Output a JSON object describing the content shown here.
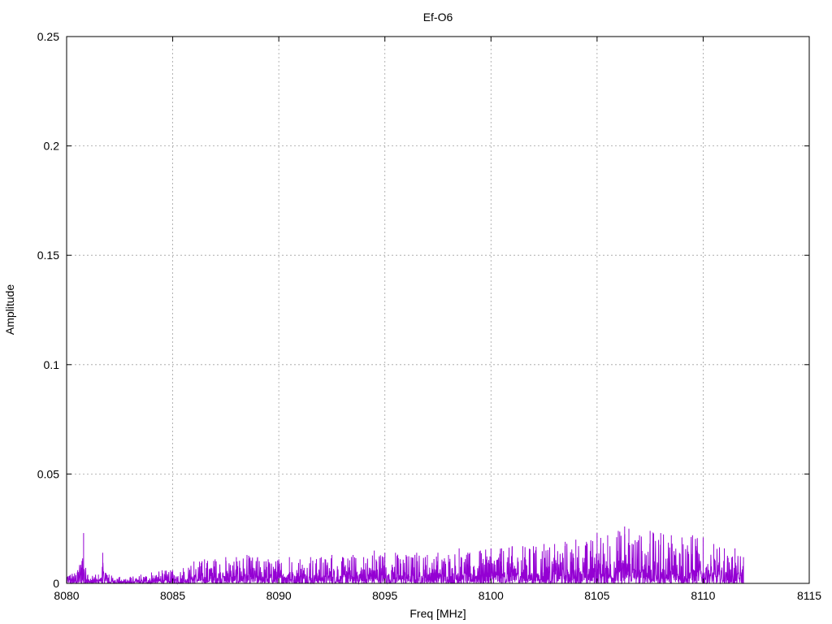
{
  "chart_data": {
    "type": "line",
    "title": "Ef-O6",
    "xlabel": "Freq [MHz]",
    "ylabel": "Amplitude",
    "xlim": [
      8080,
      8115
    ],
    "ylim": [
      0,
      0.25
    ],
    "xticks": [
      "8080",
      "8085",
      "8090",
      "8095",
      "8100",
      "8105",
      "8110",
      "8115"
    ],
    "yticks": [
      "0",
      "0.05",
      "0.1",
      "0.15",
      "0.2",
      "0.25"
    ],
    "grid": true,
    "series": [
      {
        "color": "#9400d3",
        "x": [
          8080.0,
          8080.5,
          8080.8,
          8081.0,
          8081.5,
          8081.7,
          8082.0,
          8082.5,
          8083.0,
          8083.5,
          8084.0,
          8084.5,
          8085.0,
          8085.5,
          8086.0,
          8086.5,
          8087.0,
          8087.5,
          8088.0,
          8088.5,
          8089.0,
          8089.5,
          8090.0,
          8090.5,
          8091.0,
          8091.5,
          8092.0,
          8092.5,
          8093.0,
          8093.5,
          8094.0,
          8094.5,
          8095.0,
          8095.5,
          8096.0,
          8096.5,
          8097.0,
          8097.5,
          8098.0,
          8098.5,
          8099.0,
          8099.5,
          8100.0,
          8100.5,
          8101.0,
          8101.5,
          8102.0,
          8102.5,
          8103.0,
          8103.5,
          8104.0,
          8104.5,
          8105.0,
          8105.5,
          8106.0,
          8106.3,
          8106.5,
          8107.0,
          8107.5,
          8108.0,
          8108.5,
          8109.0,
          8109.5,
          8110.0,
          8110.5,
          8111.0,
          8111.5,
          8111.9
        ],
        "y": [
          0.006,
          0.005,
          0.023,
          0.004,
          0.004,
          0.014,
          0.004,
          0.003,
          0.003,
          0.004,
          0.005,
          0.006,
          0.006,
          0.007,
          0.01,
          0.011,
          0.011,
          0.012,
          0.012,
          0.013,
          0.012,
          0.011,
          0.011,
          0.012,
          0.011,
          0.012,
          0.012,
          0.013,
          0.012,
          0.013,
          0.012,
          0.015,
          0.014,
          0.014,
          0.013,
          0.014,
          0.013,
          0.014,
          0.013,
          0.016,
          0.014,
          0.015,
          0.016,
          0.016,
          0.017,
          0.017,
          0.017,
          0.018,
          0.018,
          0.019,
          0.02,
          0.019,
          0.023,
          0.022,
          0.024,
          0.026,
          0.025,
          0.022,
          0.024,
          0.023,
          0.022,
          0.021,
          0.022,
          0.021,
          0.018,
          0.016,
          0.016,
          0.012
        ]
      }
    ]
  }
}
